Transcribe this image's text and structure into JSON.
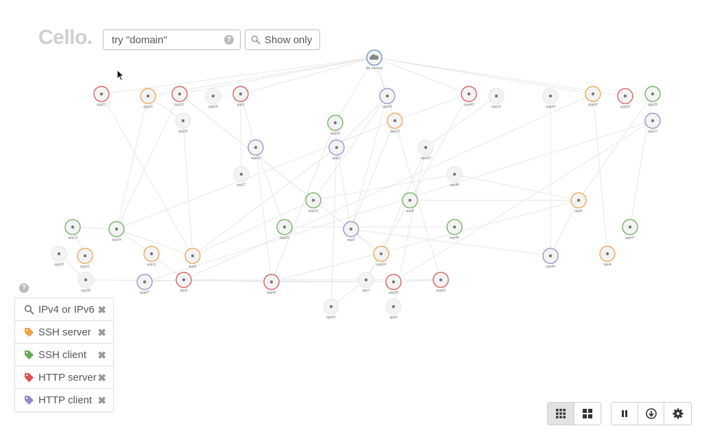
{
  "app": {
    "logo": "Cello."
  },
  "search": {
    "placeholder": "try \"domain\"",
    "help": "?"
  },
  "show_only": {
    "label": "Show only"
  },
  "colors": {
    "orange": "#f0a045",
    "green": "#6aaa5a",
    "red": "#d9534f",
    "purple": "#9a86c8",
    "blue": "#5a8ac6",
    "gray": "#cccccc"
  },
  "graph": {
    "nodes": [
      {
        "id": "the-internet",
        "label": "the internet",
        "ring": "blue",
        "icon": "cloud"
      },
      {
        "id": "app21",
        "label": "app21",
        "ring": "red"
      },
      {
        "id": "app26",
        "label": "app26",
        "ring": "orange"
      },
      {
        "id": "app16",
        "label": "app16",
        "ring": "red"
      },
      {
        "id": "app15",
        "label": "app15",
        "ring": "gray"
      },
      {
        "id": "app1",
        "label": "app1",
        "ring": "red"
      },
      {
        "id": "app30",
        "label": "app30",
        "ring": "purple"
      },
      {
        "id": "app48",
        "label": "app48",
        "ring": "red"
      },
      {
        "id": "app14",
        "label": "app14",
        "ring": "gray"
      },
      {
        "id": "app43",
        "label": "app43",
        "ring": "gray"
      },
      {
        "id": "app42",
        "label": "app42",
        "ring": "orange"
      },
      {
        "id": "app35",
        "label": "app35",
        "ring": "red"
      },
      {
        "id": "app39",
        "label": "app39",
        "ring": "green"
      },
      {
        "id": "app36",
        "label": "app36",
        "ring": "gray"
      },
      {
        "id": "app18",
        "label": "app18",
        "ring": "green"
      },
      {
        "id": "app13",
        "label": "app13",
        "ring": "orange"
      },
      {
        "id": "app22",
        "label": "app22",
        "ring": "purple"
      },
      {
        "id": "app10",
        "label": "app10",
        "ring": "purple"
      },
      {
        "id": "app17",
        "label": "app17",
        "ring": "purple"
      },
      {
        "id": "app29",
        "label": "app29",
        "ring": "gray"
      },
      {
        "id": "app27",
        "label": "app27",
        "ring": "gray"
      },
      {
        "id": "app46",
        "label": "app46",
        "ring": "gray"
      },
      {
        "id": "app19",
        "label": "app19",
        "ring": "green"
      },
      {
        "id": "app8",
        "label": "app8",
        "ring": "green"
      },
      {
        "id": "app6",
        "label": "app6",
        "ring": "orange"
      },
      {
        "id": "app12",
        "label": "app12",
        "ring": "green"
      },
      {
        "id": "app34",
        "label": "app34",
        "ring": "green"
      },
      {
        "id": "app20",
        "label": "app20",
        "ring": "green"
      },
      {
        "id": "app2",
        "label": "app2",
        "ring": "purple"
      },
      {
        "id": "app45",
        "label": "app45",
        "ring": "green"
      },
      {
        "id": "app47",
        "label": "app47",
        "ring": "green"
      },
      {
        "id": "app28",
        "label": "app28",
        "ring": "gray"
      },
      {
        "id": "app31",
        "label": "app31",
        "ring": "orange"
      },
      {
        "id": "app11",
        "label": "app11",
        "ring": "orange"
      },
      {
        "id": "app3",
        "label": "app3",
        "ring": "orange"
      },
      {
        "id": "app24",
        "label": "app24",
        "ring": "orange"
      },
      {
        "id": "app44",
        "label": "app44",
        "ring": "purple"
      },
      {
        "id": "app4",
        "label": "app4",
        "ring": "orange"
      },
      {
        "id": "app38",
        "label": "app38",
        "ring": "gray"
      },
      {
        "id": "app37",
        "label": "app37",
        "ring": "purple"
      },
      {
        "id": "app5",
        "label": "app5",
        "ring": "red"
      },
      {
        "id": "app40",
        "label": "app40",
        "ring": "red"
      },
      {
        "id": "app7",
        "label": "app7",
        "ring": "gray"
      },
      {
        "id": "app25",
        "label": "app25",
        "ring": "red"
      },
      {
        "id": "app50",
        "label": "app50",
        "ring": "red"
      },
      {
        "id": "app41",
        "label": "app41",
        "ring": "gray"
      },
      {
        "id": "app9",
        "label": "app9",
        "ring": "gray"
      }
    ],
    "edges": [
      [
        "the-internet",
        "app21"
      ],
      [
        "the-internet",
        "app16"
      ],
      [
        "the-internet",
        "app1"
      ],
      [
        "the-internet",
        "app30"
      ],
      [
        "the-internet",
        "app48"
      ],
      [
        "the-internet",
        "app42"
      ],
      [
        "the-internet",
        "app26"
      ],
      [
        "the-internet",
        "app35"
      ],
      [
        "the-internet",
        "app18"
      ],
      [
        "the-internet",
        "app13"
      ],
      [
        "app21",
        "app3"
      ],
      [
        "app26",
        "app34"
      ],
      [
        "app26",
        "app36"
      ],
      [
        "app16",
        "app34"
      ],
      [
        "app16",
        "app24"
      ],
      [
        "app1",
        "app10"
      ],
      [
        "app1",
        "app27"
      ],
      [
        "app30",
        "app17"
      ],
      [
        "app30",
        "app19"
      ],
      [
        "app30",
        "app2"
      ],
      [
        "app48",
        "app13"
      ],
      [
        "app48",
        "app8"
      ],
      [
        "app14",
        "app29"
      ],
      [
        "app43",
        "app44"
      ],
      [
        "app42",
        "app4"
      ],
      [
        "app42",
        "app5"
      ],
      [
        "app39",
        "app6"
      ],
      [
        "app22",
        "app25"
      ],
      [
        "app22",
        "app37"
      ],
      [
        "app18",
        "app17"
      ],
      [
        "app18",
        "app40"
      ],
      [
        "app13",
        "app2"
      ],
      [
        "app13",
        "app50"
      ],
      [
        "app13",
        "app34"
      ],
      [
        "app10",
        "app40"
      ],
      [
        "app10",
        "app20"
      ],
      [
        "app17",
        "app41"
      ],
      [
        "app17",
        "app3"
      ],
      [
        "app17",
        "app2"
      ],
      [
        "app29",
        "app24"
      ],
      [
        "app29",
        "app9"
      ],
      [
        "app46",
        "app6"
      ],
      [
        "app46",
        "app19"
      ],
      [
        "app19",
        "app3"
      ],
      [
        "app8",
        "app6"
      ],
      [
        "app8",
        "app7"
      ],
      [
        "app6",
        "app44"
      ],
      [
        "app6",
        "app40"
      ],
      [
        "app12",
        "app34"
      ],
      [
        "app34",
        "app11"
      ],
      [
        "app34",
        "app3"
      ],
      [
        "app2",
        "app44"
      ],
      [
        "app2",
        "app24"
      ],
      [
        "app45",
        "app20"
      ],
      [
        "app11",
        "app5"
      ],
      [
        "app3",
        "app5"
      ],
      [
        "app24",
        "app7"
      ],
      [
        "app38",
        "app25"
      ],
      [
        "app37",
        "app5"
      ],
      [
        "app5",
        "app40"
      ],
      [
        "app5",
        "app50"
      ],
      [
        "app40",
        "app25"
      ],
      [
        "app7",
        "app41"
      ],
      [
        "app25",
        "app50"
      ],
      [
        "app31",
        "app12"
      ],
      [
        "app28",
        "app38"
      ],
      [
        "app47",
        "app39"
      ],
      [
        "app36",
        "app3"
      ],
      [
        "app16",
        "app19"
      ]
    ]
  },
  "filters": {
    "help": "?",
    "items": [
      {
        "label": "IPv4 or IPv6",
        "icon": "search-icon",
        "color": "#777777"
      },
      {
        "label": "SSH server",
        "icon": "tag-icon",
        "color": "#f0a045"
      },
      {
        "label": "SSH client",
        "icon": "tag-icon",
        "color": "#6aaa5a"
      },
      {
        "label": "HTTP server",
        "icon": "tag-icon",
        "color": "#d9534f"
      },
      {
        "label": "HTTP client",
        "icon": "tag-icon",
        "color": "#9a86c8"
      }
    ],
    "close": "✖"
  },
  "toolbar": {
    "view_active": "grid-small",
    "icons": [
      "grid-small-icon",
      "grid-large-icon",
      "pause-icon",
      "download-icon",
      "gear-icon"
    ]
  }
}
